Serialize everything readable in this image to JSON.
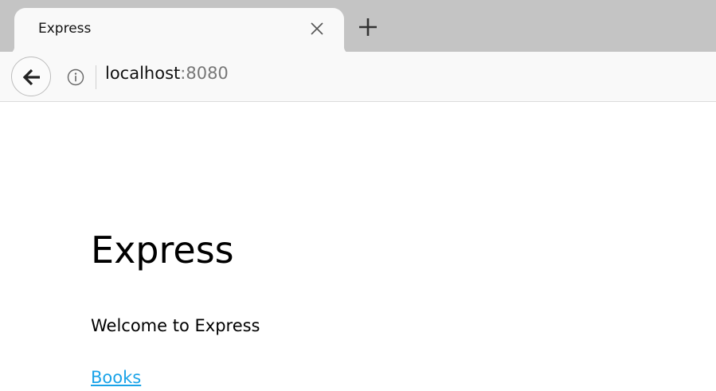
{
  "tab": {
    "title": "Express",
    "close_icon": "close-icon",
    "new_tab_icon": "plus-icon"
  },
  "nav": {
    "back_icon": "back-arrow-icon",
    "info_icon": "info-icon",
    "url_host": "localhost",
    "url_port": ":8080"
  },
  "page": {
    "title": "Express",
    "welcome_text": "Welcome to Express",
    "link_label": "Books",
    "link_color": "#1aa3e8"
  },
  "colors": {
    "tab_strip": "#c4c4c4",
    "tab_active": "#f9f9f9",
    "nav_bar": "#f9f9f9",
    "page_background": "#ffffff"
  }
}
